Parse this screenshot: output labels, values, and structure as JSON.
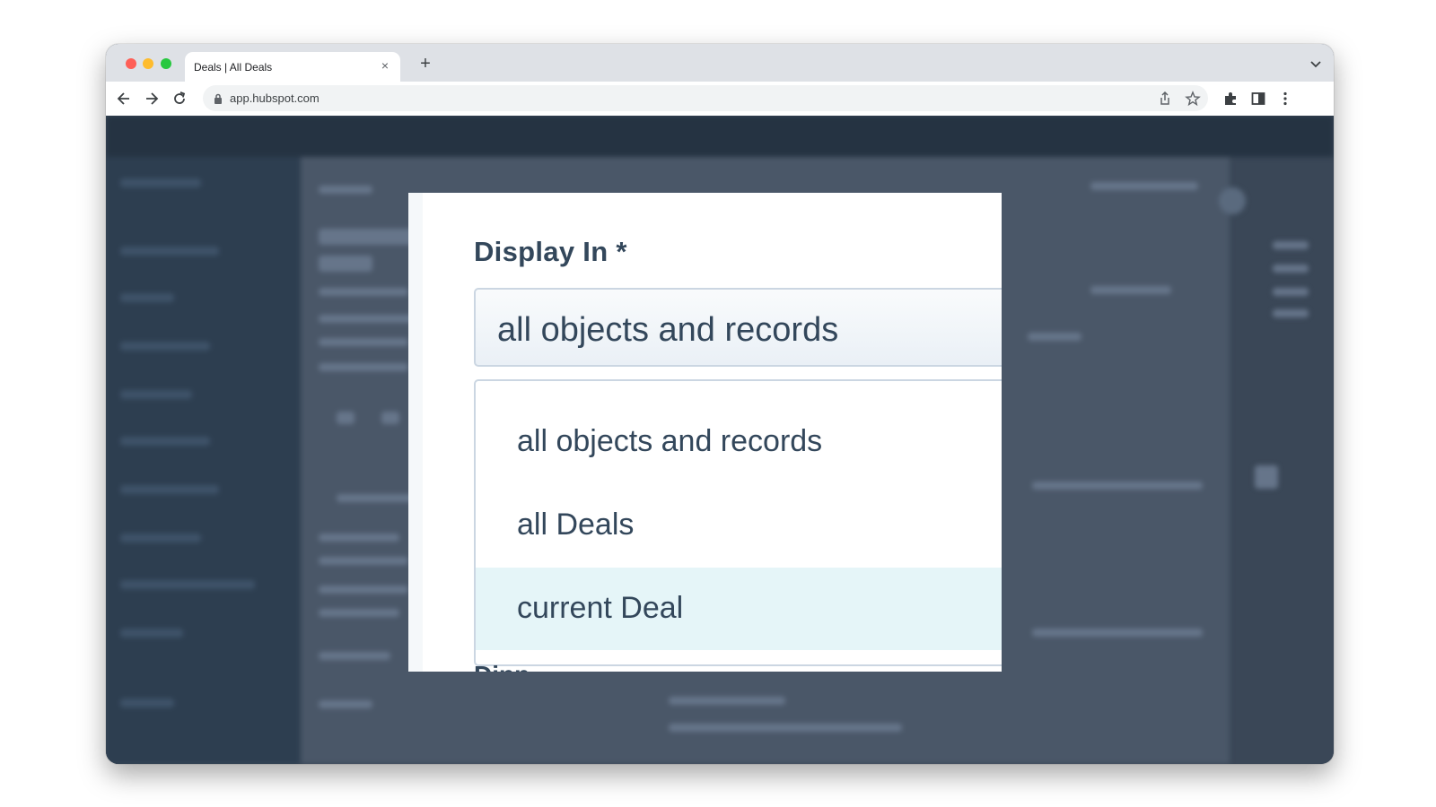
{
  "browser": {
    "tab_title": "Deals | All Deals",
    "tab_close": "×",
    "new_tab": "+",
    "url": "app.hubspot.com"
  },
  "modal": {
    "field_label": "Display In *",
    "selected_value": "all objects and records",
    "options": [
      {
        "label": "all objects and records",
        "highlighted": false
      },
      {
        "label": "all Deals",
        "highlighted": false
      },
      {
        "label": "current Deal",
        "highlighted": true
      }
    ],
    "next_field_label_partial": "Dinn"
  },
  "colors": {
    "overlay": "#3a4757",
    "option_highlight": "#e5f5f8",
    "text": "#33475b"
  }
}
